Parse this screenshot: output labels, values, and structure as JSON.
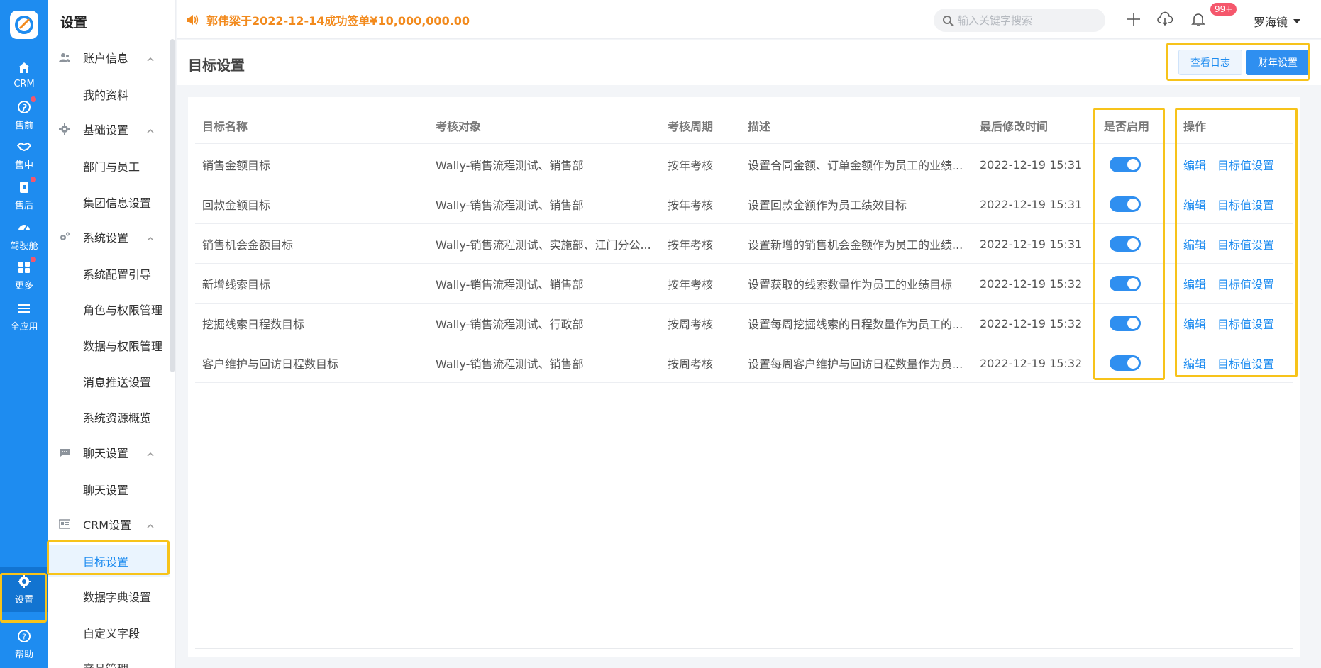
{
  "announcement": "郭伟梁于2022-12-14成功签单¥10,000,000.00",
  "search": {
    "placeholder": "输入关键字搜索"
  },
  "notifications": {
    "badge": "99+"
  },
  "user": {
    "name": "罗海镜"
  },
  "rail": {
    "items": [
      {
        "label": "CRM",
        "icon": "home-icon",
        "dot": false
      },
      {
        "label": "售前",
        "icon": "pinterest-icon",
        "dot": true
      },
      {
        "label": "售中",
        "icon": "handshake-icon",
        "dot": false
      },
      {
        "label": "售后",
        "icon": "badge-icon",
        "dot": true
      },
      {
        "label": "驾驶舱",
        "icon": "dashboard-icon",
        "dot": false
      },
      {
        "label": "更多",
        "icon": "grid-icon",
        "dot": true
      },
      {
        "label": "全应用",
        "icon": "menu-icon",
        "dot": false
      },
      {
        "label": "设置",
        "icon": "gear-icon",
        "dot": false
      },
      {
        "label": "帮助",
        "icon": "help-icon",
        "dot": false
      }
    ]
  },
  "menu": {
    "title": "设置",
    "groups": {
      "account": "账户信息",
      "basic": "基础设置",
      "system": "系统设置",
      "chat": "聊天设置",
      "crm": "CRM设置"
    },
    "items": {
      "profile": "我的资料",
      "dept": "部门与员工",
      "group_info": "集团信息设置",
      "sys_guide": "系统配置引导",
      "roles": "角色与权限管理",
      "data_perm": "数据与权限管理",
      "push": "消息推送设置",
      "resources": "系统资源概览",
      "chat_settings": "聊天设置",
      "goals": "目标设置",
      "dictionary": "数据字典设置",
      "custom_fields": "自定义字段",
      "product": "产品管理"
    }
  },
  "page": {
    "title": "目标设置",
    "view_log": "查看日志",
    "fiscal_year": "财年设置"
  },
  "table": {
    "headers": [
      "目标名称",
      "考核对象",
      "考核周期",
      "描述",
      "最后修改时间",
      "是否启用",
      "操作"
    ],
    "rows": [
      {
        "name": "销售金额目标",
        "target": "Wally-销售流程测试、销售部",
        "cycle": "按年考核",
        "desc": "设置合同金额、订单金额作为员工的业绩...",
        "time": "2022-12-19 15:31",
        "enabled": true
      },
      {
        "name": "回款金额目标",
        "target": "Wally-销售流程测试、销售部",
        "cycle": "按年考核",
        "desc": "设置回款金额作为员工绩效目标",
        "time": "2022-12-19 15:31",
        "enabled": true
      },
      {
        "name": "销售机会金额目标",
        "target": "Wally-销售流程测试、实施部、江门分公...",
        "cycle": "按年考核",
        "desc": "设置新增的销售机会金额作为员工的业绩...",
        "time": "2022-12-19 15:31",
        "enabled": true
      },
      {
        "name": "新增线索目标",
        "target": "Wally-销售流程测试、销售部",
        "cycle": "按年考核",
        "desc": "设置获取的线索数量作为员工的业绩目标",
        "time": "2022-12-19 15:32",
        "enabled": true
      },
      {
        "name": "挖掘线索日程数目标",
        "target": "Wally-销售流程测试、行政部",
        "cycle": "按周考核",
        "desc": "设置每周挖掘线索的日程数量作为员工的...",
        "time": "2022-12-19 15:32",
        "enabled": true
      },
      {
        "name": "客户维护与回访日程数目标",
        "target": "Wally-销售流程测试、销售部",
        "cycle": "按周考核",
        "desc": "设置每周客户维护与回访日程数量作为员...",
        "time": "2022-12-19 15:32",
        "enabled": true
      }
    ],
    "actions": {
      "edit": "编辑",
      "set_value": "目标值设置"
    }
  },
  "colors": {
    "brand": "#1e8cf0",
    "notice": "#f28a1d",
    "highlight": "#f7c31a",
    "badge": "#f5576c"
  }
}
